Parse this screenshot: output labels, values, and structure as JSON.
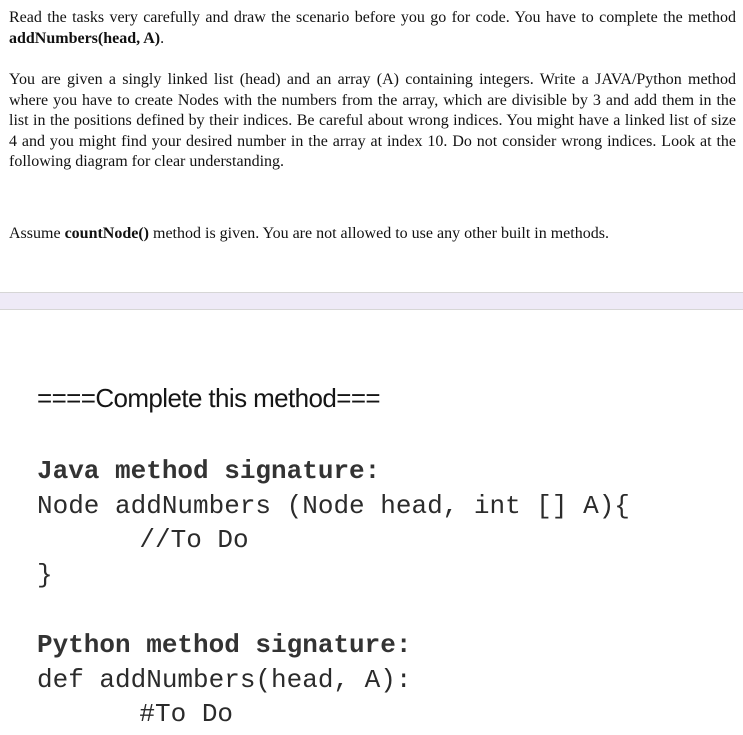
{
  "instructions": {
    "p1_pre": "Read the tasks very carefully and draw the scenario before you go for code. You have to complete the method ",
    "p1_bold": "addNumbers(head, A)",
    "p1_post": ".",
    "p2": "You are given a singly linked list (head) and an array (A) containing integers. Write a JAVA/Python method where you have to create Nodes with the numbers from the array, which are divisible by 3 and add them in the list in the positions defined by their indices. Be careful about wrong indices. You might have a linked list of size 4 and you might find your desired number in the array at index 10. Do not consider wrong indices. Look at the following diagram for clear understanding.",
    "p3_pre": "Assume ",
    "p3_bold": "countNode()",
    "p3_post": " method is given. You are not allowed to use any other built in methods."
  },
  "section": {
    "heading": "====Complete this method==="
  },
  "java": {
    "label": "Java method signature:",
    "line1": "Node addNumbers (Node head, int [] A){",
    "line2": "    //To Do",
    "line3": "}"
  },
  "python": {
    "label": "Python method signature:",
    "line1": "def addNumbers(head, A):",
    "line2": "    #To Do"
  },
  "colors": {
    "band": "#eeeaf7",
    "band_border": "#d6d6d6"
  }
}
